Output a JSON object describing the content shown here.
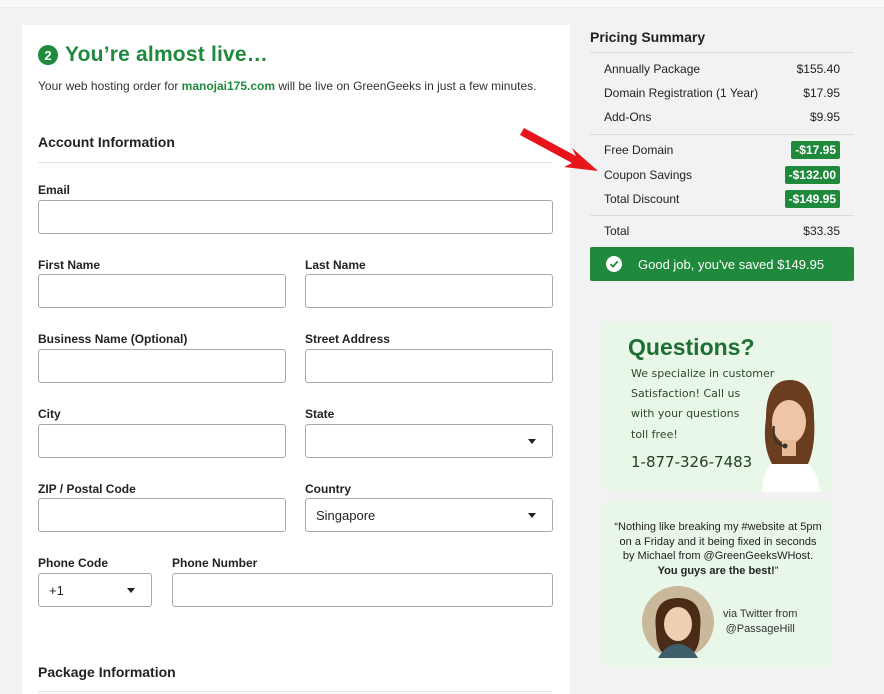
{
  "hero": {
    "step": "2",
    "title": "You’re almost live…",
    "sub_before": "Your web hosting order for ",
    "domain": "manojai175.com",
    "sub_after": " will be live on GreenGeeks in just a few minutes."
  },
  "account": {
    "title": "Account Information",
    "email_label": "Email",
    "first_name_label": "First Name",
    "last_name_label": "Last Name",
    "business_label": "Business Name (Optional)",
    "street_label": "Street Address",
    "city_label": "City",
    "state_label": "State",
    "zip_label": "ZIP / Postal Code",
    "country_label": "Country",
    "country_value": "Singapore",
    "phone_code_label": "Phone Code",
    "phone_code_value": "+1",
    "phone_number_label": "Phone Number"
  },
  "package": {
    "title": "Package Information"
  },
  "summary": {
    "title": "Pricing Summary",
    "rows": [
      {
        "label": "Annually Package",
        "value": "$155.40"
      },
      {
        "label": "Domain Registration (1 Year)",
        "value": "$17.95"
      },
      {
        "label": "Add-Ons",
        "value": "$9.95"
      }
    ],
    "discounts": [
      {
        "label": "Free Domain",
        "value": "-$17.95"
      },
      {
        "label": "Coupon Savings",
        "value": "-$132.00"
      },
      {
        "label": "Total Discount",
        "value": "-$149.95"
      }
    ],
    "total_label": "Total",
    "total_value": "$33.35",
    "saved_text": "Good job, you've saved $149.95"
  },
  "ad": {
    "heading": "Questions?",
    "line1": "We specialize in customer",
    "line2": "Satisfaction! Call us",
    "line3": "with your questions",
    "line4": "toll free!",
    "phone": "1-877-326-7483"
  },
  "testimonial": {
    "line1": "“Nothing like breaking my #website at 5pm",
    "line2": "on a Friday and it being fixed in seconds",
    "line3": "by Michael from @GreenGeeksWHost.",
    "line4": "You guys are the best!",
    "line4_end": "”",
    "via1": "via Twitter from",
    "via2": "@PassageHill"
  },
  "colors": {
    "brand_green": "#1f8a3c",
    "arrow_red": "#e8141b"
  },
  "icons": {
    "step": "circled-number-icon",
    "saved": "check-circle-icon",
    "arrow": "red-arrow-icon",
    "select": "chevron-down-icon"
  }
}
